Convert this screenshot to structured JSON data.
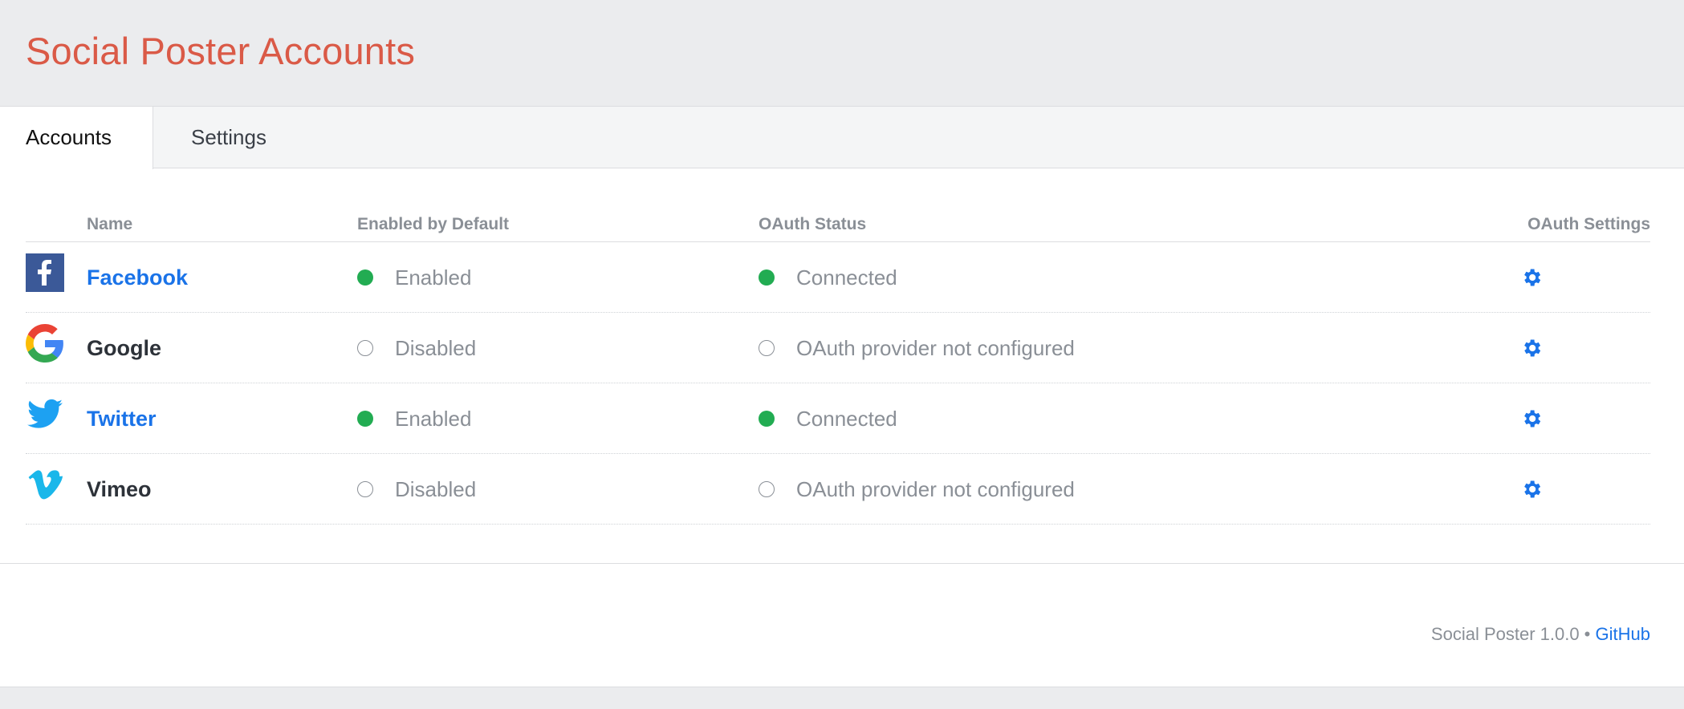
{
  "header": {
    "title": "Social Poster Accounts"
  },
  "tabs": [
    {
      "label": "Accounts",
      "active": true
    },
    {
      "label": "Settings",
      "active": false
    }
  ],
  "table": {
    "columns": [
      "Name",
      "Enabled by Default",
      "OAuth Status",
      "OAuth Settings"
    ],
    "rows": [
      {
        "icon": "facebook-icon",
        "name": "Facebook",
        "linked": true,
        "enabled": "Enabled",
        "enabled_on": true,
        "oauth": "Connected",
        "oauth_on": true
      },
      {
        "icon": "google-icon",
        "name": "Google",
        "linked": false,
        "enabled": "Disabled",
        "enabled_on": false,
        "oauth": "OAuth provider not configured",
        "oauth_on": false
      },
      {
        "icon": "twitter-icon",
        "name": "Twitter",
        "linked": true,
        "enabled": "Enabled",
        "enabled_on": true,
        "oauth": "Connected",
        "oauth_on": true
      },
      {
        "icon": "vimeo-icon",
        "name": "Vimeo",
        "linked": false,
        "enabled": "Disabled",
        "enabled_on": false,
        "oauth": "OAuth provider not configured",
        "oauth_on": false
      }
    ]
  },
  "footer": {
    "version_text": "Social Poster 1.0.0 •",
    "link_label": "GitHub"
  },
  "colors": {
    "title": "#da5a47",
    "link": "#1a73e8",
    "status_on": "#22ac52",
    "muted": "#8a8f96"
  }
}
